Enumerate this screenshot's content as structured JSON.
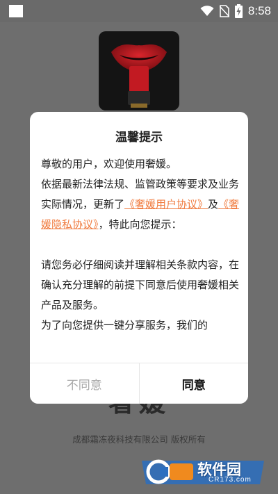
{
  "status_bar": {
    "time": "8:58",
    "icons": [
      "wifi-icon",
      "no-sim-icon",
      "battery-charging-icon"
    ]
  },
  "background": {
    "logo_icon": "red-lips-logo",
    "app_title": "奢媛",
    "copyright": "成都霜冻夜科技有限公司 版权所有",
    "watermark_text": "软件园",
    "watermark_sub": "CR173.com"
  },
  "dialog": {
    "title": "温馨提示",
    "paragraph1_line1": "尊敬的用户，欢迎使用奢媛。",
    "paragraph1_text_a": "依据最新法律法规、监管政策等要求及业务实际情况，更新了",
    "link_user_agreement": "《奢媛用户协议》",
    "paragraph1_text_b": "及",
    "link_privacy_agreement": "《奢媛隐私协议》",
    "paragraph1_text_c": "，特此向您提示：",
    "paragraph2": "请您务必仔细阅读并理解相关条款内容，在确认充分理解的前提下同意后使用奢媛相关产品及服务。",
    "paragraph3": "为了向您提供一键分享服务，我们的",
    "disagree_label": "不同意",
    "agree_label": "同意"
  },
  "colors": {
    "link": "#f07b3f",
    "overlay_background": "#6e6e6e",
    "disabled_text": "#a8a8a8"
  }
}
